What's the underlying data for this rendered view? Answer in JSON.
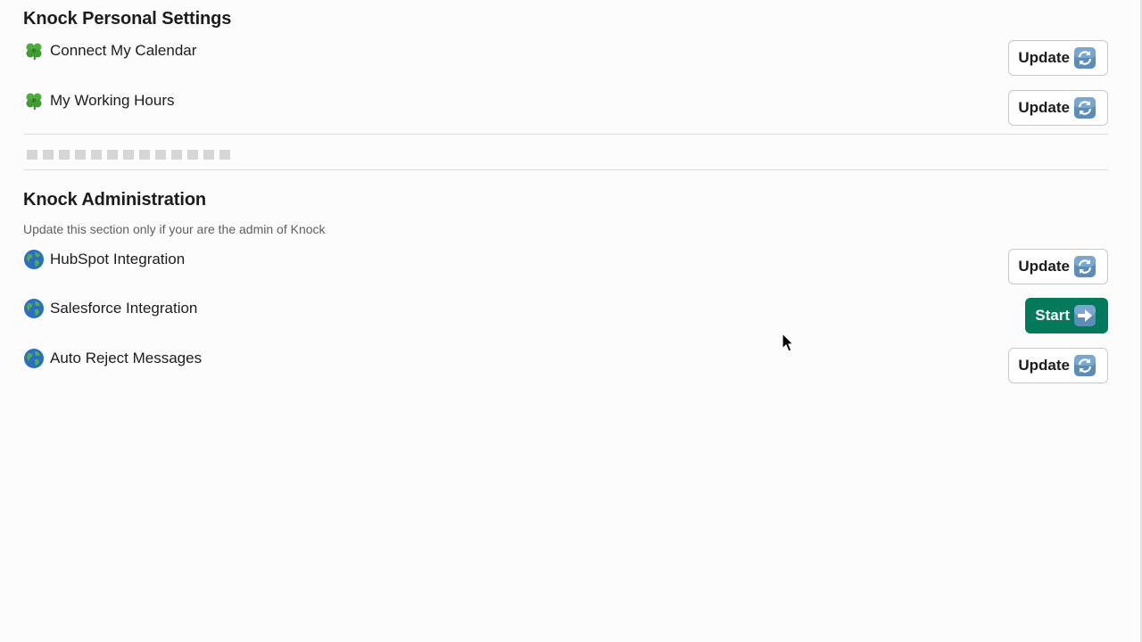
{
  "personal": {
    "title": "Knock Personal Settings",
    "items": [
      {
        "label": "Connect My Calendar",
        "icon": "four-leaf-clover-icon",
        "button_label": "Update",
        "button_icon": "refresh-icon"
      },
      {
        "label": "My Working Hours",
        "icon": "four-leaf-clover-icon",
        "button_label": "Update",
        "button_icon": "refresh-icon"
      }
    ]
  },
  "admin": {
    "title": "Knock Administration",
    "subtitle": "Update this section only if your are the admin of Knock",
    "items": [
      {
        "label": "HubSpot Integration",
        "icon": "globe-icon",
        "button_label": "Update",
        "button_icon": "refresh-icon"
      },
      {
        "label": "Salesforce Integration",
        "icon": "globe-icon",
        "button_label": "Start",
        "button_icon": "right-arrow-icon"
      },
      {
        "label": "Auto Reject Messages",
        "icon": "globe-icon",
        "button_label": "Update",
        "button_icon": "refresh-icon"
      }
    ]
  },
  "colors": {
    "primary_button": "#007a5a",
    "text": "#1d1c1d",
    "subtle_text": "#616061",
    "divider": "#dddddd",
    "placeholder": "#d6d6d6"
  }
}
